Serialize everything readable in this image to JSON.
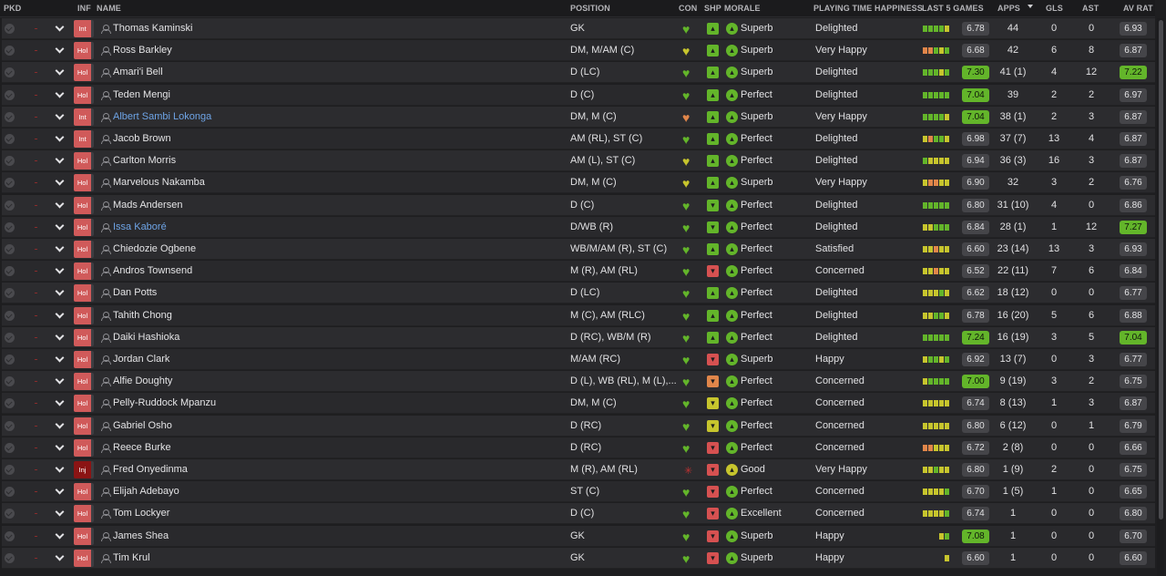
{
  "headers": {
    "pkd": "PKD",
    "inf": "INF",
    "name": "NAME",
    "position": "POSITION",
    "con": "CON",
    "shp": "SHP",
    "morale": "MORALE",
    "happiness": "PLAYING TIME HAPPINESS",
    "last5": "LAST 5 GAMES",
    "apps": "APPS",
    "gls": "GLS",
    "ast": "AST",
    "avrat": "AV RAT"
  },
  "colors": {
    "green": "#63b52a",
    "yellow": "#c7c52d",
    "orange": "#e1864a",
    "red": "#d65151",
    "gray": "#6a6a6e"
  },
  "players": [
    {
      "inf": "Int",
      "name": "Thomas Kaminski",
      "link": false,
      "position": "GK",
      "con": "green",
      "ship": "green-up",
      "morale": "Superb",
      "happiness": "Delighted",
      "games": [
        "g",
        "g",
        "g",
        "g",
        "y"
      ],
      "l5": "6.78",
      "l5hl": false,
      "apps": "44",
      "gls": "0",
      "ast": "0",
      "av": "6.93",
      "avhl": false
    },
    {
      "inf": "Hol",
      "name": "Ross Barkley",
      "link": false,
      "position": "DM, M/AM (C)",
      "con": "yellow-down",
      "ship": "green-up",
      "morale": "Superb",
      "happiness": "Very Happy",
      "games": [
        "o",
        "o",
        "g",
        "y",
        "g"
      ],
      "l5": "6.68",
      "l5hl": false,
      "apps": "42",
      "gls": "6",
      "ast": "8",
      "av": "6.87",
      "avhl": false
    },
    {
      "inf": "Hol",
      "name": "Amari'i Bell",
      "link": false,
      "position": "D (LC)",
      "con": "green",
      "ship": "green-up",
      "morale": "Superb",
      "happiness": "Delighted",
      "games": [
        "g",
        "g",
        "g",
        "y",
        "g"
      ],
      "l5": "7.30",
      "l5hl": true,
      "apps": "41 (1)",
      "gls": "4",
      "ast": "12",
      "av": "7.22",
      "avhl": true
    },
    {
      "inf": "Hol",
      "name": "Teden Mengi",
      "link": false,
      "position": "D (C)",
      "con": "green",
      "ship": "green-up2",
      "morale": "Perfect",
      "happiness": "Delighted",
      "games": [
        "g",
        "g",
        "g",
        "g",
        "g"
      ],
      "l5": "7.04",
      "l5hl": true,
      "apps": "39",
      "gls": "2",
      "ast": "2",
      "av": "6.97",
      "avhl": false
    },
    {
      "inf": "Int",
      "name": "Albert Sambi Lokonga",
      "link": true,
      "position": "DM, M (C)",
      "con": "orange-down",
      "ship": "green-up",
      "morale": "Superb",
      "happiness": "Very Happy",
      "games": [
        "g",
        "g",
        "g",
        "g",
        "y"
      ],
      "l5": "7.04",
      "l5hl": true,
      "apps": "38 (1)",
      "gls": "2",
      "ast": "3",
      "av": "6.87",
      "avhl": false
    },
    {
      "inf": "Int",
      "name": "Jacob Brown",
      "link": false,
      "position": "AM (RL), ST (C)",
      "con": "green",
      "ship": "green-up",
      "morale": "Perfect",
      "happiness": "Delighted",
      "games": [
        "y",
        "o",
        "g",
        "g",
        "y"
      ],
      "l5": "6.98",
      "l5hl": false,
      "apps": "37 (7)",
      "gls": "13",
      "ast": "4",
      "av": "6.87",
      "avhl": false
    },
    {
      "inf": "Hol",
      "name": "Carlton Morris",
      "link": false,
      "position": "AM (L), ST (C)",
      "con": "yellow",
      "ship": "green-up2",
      "morale": "Perfect",
      "happiness": "Delighted",
      "games": [
        "g",
        "y",
        "y",
        "y",
        "y"
      ],
      "l5": "6.94",
      "l5hl": false,
      "apps": "36 (3)",
      "gls": "16",
      "ast": "3",
      "av": "6.87",
      "avhl": false
    },
    {
      "inf": "Hol",
      "name": "Marvelous Nakamba",
      "link": false,
      "position": "DM, M (C)",
      "con": "yellow",
      "ship": "green-up",
      "morale": "Superb",
      "happiness": "Very Happy",
      "games": [
        "y",
        "o",
        "o",
        "y",
        "y"
      ],
      "l5": "6.90",
      "l5hl": false,
      "apps": "32",
      "gls": "3",
      "ast": "2",
      "av": "6.76",
      "avhl": false
    },
    {
      "inf": "Hol",
      "name": "Mads Andersen",
      "link": false,
      "position": "D (C)",
      "con": "green",
      "ship": "green-down",
      "morale": "Perfect",
      "happiness": "Delighted",
      "games": [
        "g",
        "g",
        "g",
        "g",
        "g"
      ],
      "l5": "6.80",
      "l5hl": false,
      "apps": "31 (10)",
      "gls": "4",
      "ast": "0",
      "av": "6.86",
      "avhl": false
    },
    {
      "inf": "Hol",
      "name": "Issa Kaboré",
      "link": true,
      "position": "D/WB (R)",
      "con": "green",
      "ship": "green-down",
      "morale": "Perfect",
      "happiness": "Delighted",
      "games": [
        "y",
        "y",
        "g",
        "g",
        "g"
      ],
      "l5": "6.84",
      "l5hl": false,
      "apps": "28 (1)",
      "gls": "1",
      "ast": "12",
      "av": "7.27",
      "avhl": true
    },
    {
      "inf": "Hol",
      "name": "Chiedozie Ogbene",
      "link": false,
      "position": "WB/M/AM (R), ST (C)",
      "con": "green",
      "ship": "green-up",
      "morale": "Perfect",
      "happiness": "Satisfied",
      "games": [
        "y",
        "y",
        "o",
        "y",
        "y"
      ],
      "l5": "6.60",
      "l5hl": false,
      "apps": "23 (14)",
      "gls": "13",
      "ast": "3",
      "av": "6.93",
      "avhl": false
    },
    {
      "inf": "Hol",
      "name": "Andros Townsend",
      "link": false,
      "position": "M (R), AM (RL)",
      "con": "green",
      "ship": "red-down",
      "morale": "Perfect",
      "happiness": "Concerned",
      "games": [
        "y",
        "y",
        "o",
        "y",
        "y"
      ],
      "l5": "6.52",
      "l5hl": false,
      "apps": "22 (11)",
      "gls": "7",
      "ast": "6",
      "av": "6.84",
      "avhl": false
    },
    {
      "inf": "Hol",
      "name": "Dan Potts",
      "link": false,
      "position": "D (LC)",
      "con": "green",
      "ship": "green-up",
      "morale": "Perfect",
      "happiness": "Delighted",
      "games": [
        "y",
        "y",
        "y",
        "g",
        "y"
      ],
      "l5": "6.62",
      "l5hl": false,
      "apps": "18 (12)",
      "gls": "0",
      "ast": "0",
      "av": "6.77",
      "avhl": false
    },
    {
      "inf": "Hol",
      "name": "Tahith Chong",
      "link": false,
      "position": "M (C), AM (RLC)",
      "con": "green",
      "ship": "green-up",
      "morale": "Perfect",
      "happiness": "Delighted",
      "games": [
        "y",
        "y",
        "g",
        "g",
        "y"
      ],
      "l5": "6.78",
      "l5hl": false,
      "apps": "16 (20)",
      "gls": "5",
      "ast": "6",
      "av": "6.88",
      "avhl": false
    },
    {
      "inf": "Hol",
      "name": "Daiki Hashioka",
      "link": false,
      "position": "D (RC), WB/M (R)",
      "con": "green",
      "ship": "green-up2",
      "morale": "Perfect",
      "happiness": "Delighted",
      "games": [
        "g",
        "g",
        "g",
        "g",
        "g"
      ],
      "l5": "7.24",
      "l5hl": true,
      "apps": "16 (19)",
      "gls": "3",
      "ast": "5",
      "av": "7.04",
      "avhl": true
    },
    {
      "inf": "Hol",
      "name": "Jordan Clark",
      "link": false,
      "position": "M/AM (RC)",
      "con": "green",
      "ship": "red-down",
      "morale": "Superb",
      "happiness": "Happy",
      "games": [
        "y",
        "g",
        "g",
        "y",
        "g"
      ],
      "l5": "6.92",
      "l5hl": false,
      "apps": "13 (7)",
      "gls": "0",
      "ast": "3",
      "av": "6.77",
      "avhl": false
    },
    {
      "inf": "Hol",
      "name": "Alfie Doughty",
      "link": false,
      "position": "D (L), WB (RL), M (L),...",
      "con": "green",
      "ship": "orange-down",
      "morale": "Perfect",
      "happiness": "Concerned",
      "games": [
        "y",
        "g",
        "g",
        "g",
        "g"
      ],
      "l5": "7.00",
      "l5hl": true,
      "apps": "9 (19)",
      "gls": "3",
      "ast": "2",
      "av": "6.75",
      "avhl": false
    },
    {
      "inf": "Hol",
      "name": "Pelly-Ruddock Mpanzu",
      "link": false,
      "position": "DM, M (C)",
      "con": "green",
      "ship": "yellow-down",
      "morale": "Perfect",
      "happiness": "Concerned",
      "games": [
        "y",
        "y",
        "y",
        "y",
        "y"
      ],
      "l5": "6.74",
      "l5hl": false,
      "apps": "8 (13)",
      "gls": "1",
      "ast": "3",
      "av": "6.87",
      "avhl": false
    },
    {
      "inf": "Hol",
      "name": "Gabriel Osho",
      "link": false,
      "position": "D (RC)",
      "con": "green",
      "ship": "yellow-down",
      "morale": "Perfect",
      "happiness": "Concerned",
      "games": [
        "y",
        "y",
        "y",
        "y",
        "y"
      ],
      "l5": "6.80",
      "l5hl": false,
      "apps": "6 (12)",
      "gls": "0",
      "ast": "1",
      "av": "6.79",
      "avhl": false
    },
    {
      "inf": "Hol",
      "name": "Reece Burke",
      "link": false,
      "position": "D (RC)",
      "con": "green",
      "ship": "red-down",
      "morale": "Perfect",
      "happiness": "Concerned",
      "games": [
        "o",
        "o",
        "y",
        "y",
        "y"
      ],
      "l5": "6.72",
      "l5hl": false,
      "apps": "2 (8)",
      "gls": "0",
      "ast": "0",
      "av": "6.66",
      "avhl": false
    },
    {
      "inf": "Inj",
      "name": "Fred Onyedinma",
      "link": false,
      "position": "M (R), AM (RL)",
      "con": "injury",
      "ship": "red-down",
      "morale": "Good",
      "happiness": "Very Happy",
      "games": [
        "y",
        "y",
        "g",
        "y",
        "y"
      ],
      "l5": "6.80",
      "l5hl": false,
      "apps": "1 (9)",
      "gls": "2",
      "ast": "0",
      "av": "6.75",
      "avhl": false
    },
    {
      "inf": "Hol",
      "name": "Elijah Adebayo",
      "link": false,
      "position": "ST (C)",
      "con": "green",
      "ship": "red-down",
      "morale": "Perfect",
      "happiness": "Concerned",
      "games": [
        "y",
        "y",
        "y",
        "y",
        "g"
      ],
      "l5": "6.70",
      "l5hl": false,
      "apps": "1 (5)",
      "gls": "1",
      "ast": "0",
      "av": "6.65",
      "avhl": false
    },
    {
      "inf": "Hol",
      "name": "Tom Lockyer",
      "link": false,
      "position": "D (C)",
      "con": "green",
      "ship": "red-down",
      "morale": "Excellent",
      "happiness": "Concerned",
      "games": [
        "y",
        "y",
        "y",
        "y",
        "g"
      ],
      "l5": "6.74",
      "l5hl": false,
      "apps": "1",
      "gls": "0",
      "ast": "0",
      "av": "6.80",
      "avhl": false
    },
    {
      "inf": "Hol",
      "name": "James Shea",
      "link": false,
      "position": "GK",
      "con": "green",
      "ship": "red-down",
      "morale": "Superb",
      "happiness": "Happy",
      "games": [
        "",
        "",
        "",
        "y",
        "g"
      ],
      "l5": "7.08",
      "l5hl": true,
      "apps": "1",
      "gls": "0",
      "ast": "0",
      "av": "6.70",
      "avhl": false
    },
    {
      "inf": "Hol",
      "name": "Tim Krul",
      "link": false,
      "position": "GK",
      "con": "green",
      "ship": "red-down",
      "morale": "Superb",
      "happiness": "Happy",
      "games": [
        "",
        "",
        "",
        "",
        "y"
      ],
      "l5": "6.60",
      "l5hl": false,
      "apps": "1",
      "gls": "0",
      "ast": "0",
      "av": "6.60",
      "avhl": false
    }
  ]
}
